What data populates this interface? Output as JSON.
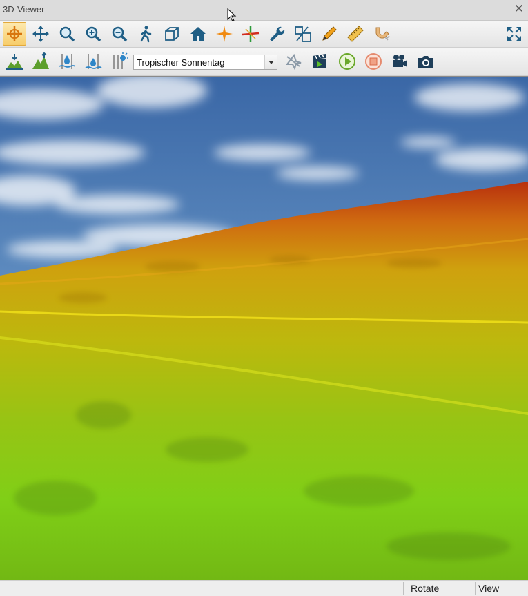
{
  "window": {
    "title": "3D-Viewer",
    "close_glyph": "✕"
  },
  "toolbar1": {
    "buttons": [
      {
        "name": "rotate-tool",
        "icon": "rotate-crosshair-icon",
        "active": true
      },
      {
        "name": "pan-tool",
        "icon": "move-arrows-icon"
      },
      {
        "name": "zoom-tool",
        "icon": "magnifier-icon"
      },
      {
        "name": "zoom-in-tool",
        "icon": "zoom-in-icon"
      },
      {
        "name": "zoom-out-tool",
        "icon": "zoom-out-icon"
      },
      {
        "name": "walk-tool",
        "icon": "walking-person-icon"
      },
      {
        "name": "perspective-tool",
        "icon": "cube-icon"
      },
      {
        "name": "home-view",
        "icon": "house-icon"
      },
      {
        "name": "center-point-tool",
        "icon": "orange-star-icon"
      },
      {
        "name": "axis-tool",
        "icon": "color-axis-icon"
      },
      {
        "name": "settings-tool",
        "icon": "wrench-icon"
      },
      {
        "name": "scale-tool",
        "icon": "scale-squares-icon"
      },
      {
        "name": "draw-tool",
        "icon": "pencil-icon"
      },
      {
        "name": "measure-tool",
        "icon": "ruler-icon"
      },
      {
        "name": "snap-tool",
        "icon": "magnet-icon"
      }
    ],
    "fullscreen_icon": "expand-arrows-icon"
  },
  "toolbar2": {
    "buttons": [
      {
        "name": "terrain-down-tool",
        "icon": "terrain-down-icon"
      },
      {
        "name": "terrain-up-tool",
        "icon": "terrain-up-icon"
      },
      {
        "name": "water-level-tool",
        "icon": "water-level-icon"
      },
      {
        "name": "water-level-down-tool",
        "icon": "water-level-down-icon"
      },
      {
        "name": "light-tool",
        "icon": "light-grid-icon"
      }
    ],
    "sky_preset": {
      "selected": "Tropischer Sonnentag"
    },
    "media_buttons": [
      {
        "name": "flight-path-button",
        "icon": "plane-disabled-icon"
      },
      {
        "name": "clapper-button",
        "icon": "clapperboard-icon"
      },
      {
        "name": "play-button",
        "icon": "play-circle-icon"
      },
      {
        "name": "stop-button",
        "icon": "stop-circle-icon"
      },
      {
        "name": "record-video-button",
        "icon": "video-camera-icon"
      },
      {
        "name": "screenshot-button",
        "icon": "photo-camera-icon"
      }
    ]
  },
  "statusbar": {
    "mode": "Rotate",
    "section": "View"
  },
  "colors": {
    "sky_top": "#3c6aa8",
    "sky_bottom": "#9ec0dc",
    "terrain_red": "#c23a10",
    "terrain_yellow": "#c9b00d",
    "terrain_green": "#7fd41a",
    "active_button": "#f7cd6a"
  }
}
